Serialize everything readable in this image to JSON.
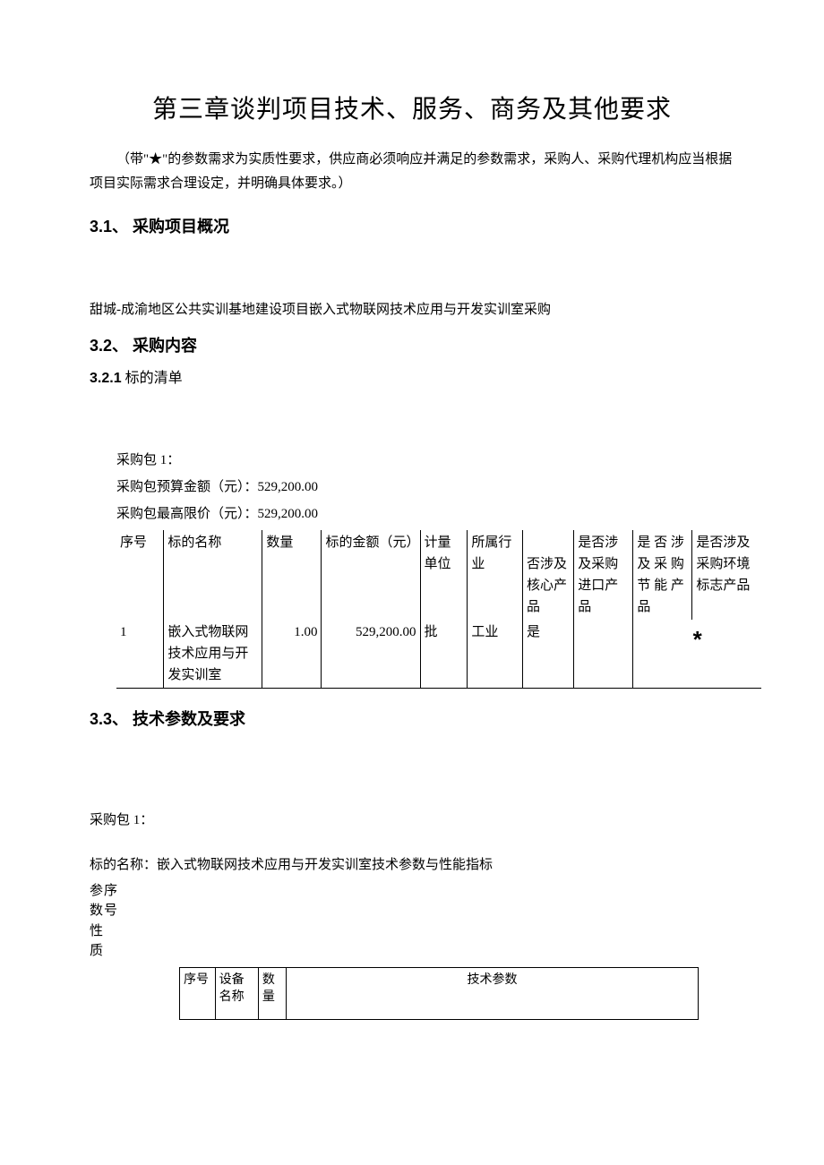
{
  "chapter_title": "第三章谈判项目技术、服务、商务及其他要求",
  "note_text": "（带\"★\"的参数需求为实质性要求，供应商必须响应并满足的参数需求，采购人、采购代理机构应当根据项目实际需求合理设定，并明确具体要求。）",
  "section_3_1": {
    "num": "3.1、",
    "title": "采购项目概况"
  },
  "overview_text": "甜城-成渝地区公共实训基地建设项目嵌入式物联网技术应用与开发实训室采购",
  "section_3_2": {
    "num": "3.2、",
    "title": "采购内容"
  },
  "section_3_2_1": {
    "num": "3.2.1",
    "title": "标的清单"
  },
  "package_label": "采购包 1：",
  "budget_line": "采购包预算金额（元）：529,200.00",
  "ceiling_line": "采购包最高限价（元）：529,200.00",
  "table1": {
    "headers": {
      "seq": "序号",
      "name": "标的名称",
      "qty": "数量",
      "amount": "标的金额（元）",
      "unit": "计量单位",
      "industry": "所属行业",
      "core": "否涉及核心产品",
      "import": "是否涉及采购进口产品",
      "energy": "是 否 涉及 采 购节 能 产品",
      "env": "是否涉及采购环境标志产品"
    },
    "row": {
      "seq": "1",
      "name": "嵌入式物联网技术应用与开发实训室",
      "qty": "1.00",
      "amount": "529,200.00",
      "unit": "批",
      "industry": "工业",
      "core": "是",
      "star": "*"
    }
  },
  "section_3_3": {
    "num": "3.3、",
    "title": "技术参数及要求"
  },
  "package_label2": "采购包 1：",
  "target_name_line": "标的名称：嵌入式物联网技术应用与开发实训室技术参数与性能指标",
  "param_left": "参数性质",
  "param_left2": "序号",
  "table2": {
    "seq": "序号",
    "devname": "设备名称",
    "qty": "数量",
    "spec": "技术参数"
  }
}
